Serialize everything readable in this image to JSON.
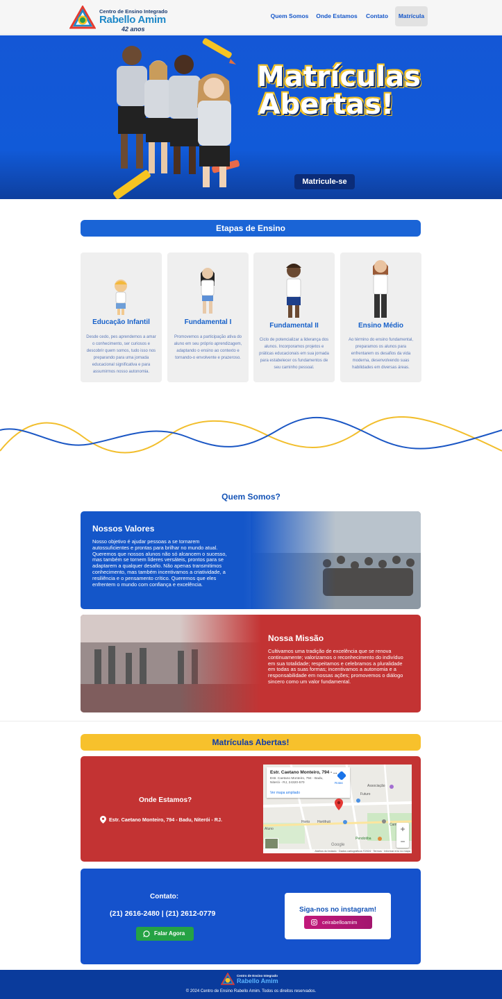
{
  "header": {
    "logo": {
      "line1": "Centro de Ensino Integrado",
      "line2": "Rabello Amim",
      "line3": "42 anos"
    },
    "nav": [
      {
        "label": "Quem Somos"
      },
      {
        "label": "Onde Estamos"
      },
      {
        "label": "Contato"
      },
      {
        "label": "Matrícula"
      }
    ]
  },
  "hero": {
    "title_line1": "Matrículas",
    "title_line2": "Abertas!",
    "button": "Matricule-se"
  },
  "etapas": {
    "title": "Etapas de Ensino",
    "cards": [
      {
        "title": "Educação Infantil",
        "text": "Desde cedo, pes aprendemos a amar o conhecimento, ser curiosos e descobrir quem somos, tudo isso nos preparando para uma jornada educacional significativa e para assumirmos nosso autonomia."
      },
      {
        "title": "Fundamental I",
        "text": "Promovemos a participação ativa do aluno em seu próprio aprendizagem, adaptando o ensino ao contexto e tornando-o envolvente e prazeroso."
      },
      {
        "title": "Fundamental II",
        "text": "Ciclo de potencializar a liderança dos alunos. Incorporamos projetos e práticas educacionais em sua jornada para estabelecer os fundamentos de seu caminho pessoal."
      },
      {
        "title": "Ensino Médio",
        "text": "Ao término do ensino fundamental, preparamos os alunos para enfrentarem os desafios da vida moderna, desenvolvendo suas habilidades em diversas áreas."
      }
    ]
  },
  "quem_somos": {
    "title": "Quem Somos?",
    "valores": {
      "title": "Nossos Valores",
      "text": "Nosso objetivo é ajudar pessoas a se tornarem autossuficientes e prontas para brilhar no mundo atual. Queremos que nossos alunos não só alcancem o sucesso, mas também se tornem líderes versáteis, prontos para se adaptarem a qualquer desafio. Não apenas transmitimos conhecimento, mas também incentivamos a criatividade, a resiliência e o pensamento crítico. Queremos que eles enfrentem o mundo com confiança e excelência."
    },
    "missao": {
      "title": "Nossa Missão",
      "text": "Cultivamos uma tradição de excelência que se renova continuamente; valorizamos o reconhecimento do indivíduo em sua totalidade; respeitamos e celebramos a pluralidade em todas as suas formas; incentivamos a autonomia e a responsabilidade em nossas ações; promovemos o diálogo sincero como um valor fundamental."
    }
  },
  "matriculas": {
    "title": "Matrículas Abertas!"
  },
  "onde": {
    "title": "Onde Estamos?",
    "address": "Estr. Caetano Monteiro, 794 - Badu, Niterói - RJ.",
    "map": {
      "card_title": "Estr. Caetano Monteiro, 794 - ...",
      "card_line1": "Estr. Caetano Monteiro, 794 - Badu,",
      "card_line2": "Niterói - RJ, 24320-570",
      "card_link": "Ver mapa ampliado",
      "route": "Rotas",
      "labels": [
        "Associação",
        "Futuro",
        "Horto",
        "Aluno",
        "Hortifruti",
        "Pendotiba",
        "Google",
        "Campo"
      ],
      "footer": "Atalhos do teclado · Dados cartográficos ©2024 · Termos · Informar erro no mapa"
    }
  },
  "contato": {
    "title": "Contato:",
    "phones": "(21) 2616-2480 | (21) 2612-0779",
    "button": "Falar Agora",
    "insta_title": "Siga-nos no instagram!",
    "insta_handle": "ceirabelloamim"
  },
  "footer": {
    "logo_line1": "Centro de Ensino Integrado",
    "logo_line2": "Rabello Amim",
    "copyright": "© 2024 Centro de Ensino Rabello Amim. Todos os direitos reservados."
  },
  "colors": {
    "primary_blue": "#1456c9",
    "accent_yellow": "#f7c12c",
    "red": "#c33333",
    "whatsapp": "#25a244",
    "instagram": "#c2187a"
  }
}
